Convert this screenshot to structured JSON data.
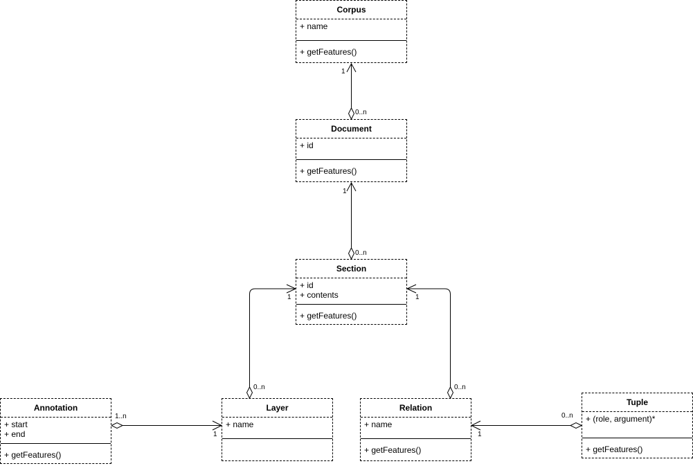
{
  "classes": {
    "corpus": {
      "name": "Corpus",
      "attributes": [
        "+ name"
      ],
      "operations": [
        "+ getFeatures()"
      ]
    },
    "document": {
      "name": "Document",
      "attributes": [
        "+ id"
      ],
      "operations": [
        "+ getFeatures()"
      ]
    },
    "section": {
      "name": "Section",
      "attributes": [
        "+ id",
        "+ contents"
      ],
      "operations": [
        "+ getFeatures()"
      ]
    },
    "annotation": {
      "name": "Annotation",
      "attributes": [
        "+ start",
        "+ end"
      ],
      "operations": [
        "+ getFeatures()"
      ]
    },
    "layer": {
      "name": "Layer",
      "attributes": [
        "+ name"
      ],
      "operations": []
    },
    "relation": {
      "name": "Relation",
      "attributes": [
        "+ name"
      ],
      "operations": [
        "+ getFeatures()"
      ]
    },
    "tuple": {
      "name": "Tuple",
      "attributes": [
        "+ (role, argument)*"
      ],
      "operations": [
        "+ getFeatures()"
      ]
    }
  },
  "associations": [
    {
      "from": "Document",
      "to": "Corpus",
      "type": "aggregation",
      "source_multiplicity": "0..n",
      "target_multiplicity": "1"
    },
    {
      "from": "Section",
      "to": "Document",
      "type": "aggregation",
      "source_multiplicity": "0..n",
      "target_multiplicity": "1"
    },
    {
      "from": "Layer",
      "to": "Section",
      "type": "aggregation",
      "source_multiplicity": "0..n",
      "target_multiplicity": "1"
    },
    {
      "from": "Relation",
      "to": "Section",
      "type": "aggregation",
      "source_multiplicity": "0..n",
      "target_multiplicity": "1"
    },
    {
      "from": "Annotation",
      "to": "Layer",
      "type": "aggregation",
      "source_multiplicity": "1..n",
      "target_multiplicity": "1"
    },
    {
      "from": "Tuple",
      "to": "Relation",
      "type": "aggregation",
      "source_multiplicity": "0..n",
      "target_multiplicity": "1"
    }
  ]
}
